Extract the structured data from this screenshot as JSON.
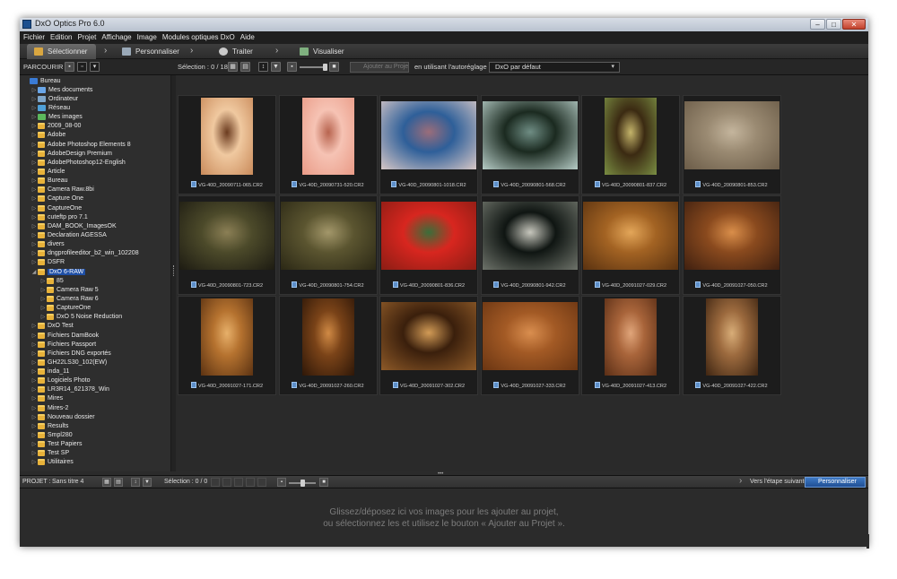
{
  "window": {
    "title": "DxO Optics Pro 6.0",
    "minimize": "–",
    "maximize": "□",
    "close": "✕"
  },
  "menu": [
    "Fichier",
    "Edition",
    "Projet",
    "Affichage",
    "Image",
    "Modules optiques DxO",
    "Aide"
  ],
  "steps": {
    "select": "Sélectionner",
    "customize": "Personnaliser",
    "process": "Traiter",
    "view": "Visualiser",
    "chevron": "›"
  },
  "toolbar": {
    "browse_label": "PARCOURIR :",
    "selection": "Sélection : 0 / 18",
    "add_button": "Ajouter au Projet",
    "autopreset_label": "en utilisant l'autoréglage :",
    "preset_value": "DxO par défaut",
    "preset_arrow": "▾"
  },
  "tree": [
    {
      "label": "Bureau",
      "level": 0,
      "icon": "desktop-icon",
      "exp": ""
    },
    {
      "label": "Mes documents",
      "level": 1,
      "icon": "documents-icon",
      "exp": "▷"
    },
    {
      "label": "Ordinateur",
      "level": 1,
      "icon": "computer-icon",
      "exp": "▷"
    },
    {
      "label": "Réseau",
      "level": 1,
      "icon": "network-icon",
      "exp": "▷"
    },
    {
      "label": "Mes images",
      "level": 1,
      "icon": "pictures-icon",
      "exp": "▷"
    },
    {
      "label": "2009_08-00",
      "level": 1,
      "icon": "folder-icon",
      "exp": "▷"
    },
    {
      "label": "Adobe",
      "level": 1,
      "icon": "folder-icon",
      "exp": "▷"
    },
    {
      "label": "Adobe Photoshop Elements 8",
      "level": 1,
      "icon": "folder-icon",
      "exp": "▷"
    },
    {
      "label": "AdobeDesign Premium",
      "level": 1,
      "icon": "folder-icon",
      "exp": "▷"
    },
    {
      "label": "AdobePhotoshop12-English",
      "level": 1,
      "icon": "folder-icon",
      "exp": "▷"
    },
    {
      "label": "Article",
      "level": 1,
      "icon": "folder-icon",
      "exp": "▷"
    },
    {
      "label": "Bureau",
      "level": 1,
      "icon": "folder-icon",
      "exp": "▷"
    },
    {
      "label": "Camera Raw.8bi",
      "level": 1,
      "icon": "folder-icon",
      "exp": "▷"
    },
    {
      "label": "Capture One",
      "level": 1,
      "icon": "folder-icon",
      "exp": "▷"
    },
    {
      "label": "CaptureOne",
      "level": 1,
      "icon": "folder-icon",
      "exp": "▷"
    },
    {
      "label": "cuteftp pro 7.1",
      "level": 1,
      "icon": "folder-icon",
      "exp": "▷"
    },
    {
      "label": "DAM_BOOK_ImagesOK",
      "level": 1,
      "icon": "folder-icon",
      "exp": "▷"
    },
    {
      "label": "Declaration AGESSA",
      "level": 1,
      "icon": "folder-icon",
      "exp": "▷"
    },
    {
      "label": "divers",
      "level": 1,
      "icon": "folder-icon",
      "exp": "▷"
    },
    {
      "label": "dngprofileeditor_b2_win_102208",
      "level": 1,
      "icon": "folder-icon",
      "exp": "▷"
    },
    {
      "label": "DSFR",
      "level": 1,
      "icon": "folder-icon",
      "exp": "▷"
    },
    {
      "label": "DxO 6-RAW",
      "level": 1,
      "icon": "folder-icon",
      "exp": "◢",
      "selected": true
    },
    {
      "label": "85",
      "level": 2,
      "icon": "folder-icon",
      "exp": "▷"
    },
    {
      "label": "Camera Raw 5",
      "level": 2,
      "icon": "folder-icon",
      "exp": "▷"
    },
    {
      "label": "Camera Raw 6",
      "level": 2,
      "icon": "folder-icon",
      "exp": "▷"
    },
    {
      "label": "CaptureOne",
      "level": 2,
      "icon": "folder-icon",
      "exp": "▷"
    },
    {
      "label": "DxO 5 Noise Reduction",
      "level": 2,
      "icon": "folder-icon",
      "exp": "▷"
    },
    {
      "label": "DxO Test",
      "level": 1,
      "icon": "folder-icon",
      "exp": "▷"
    },
    {
      "label": "Fichiers DamBook",
      "level": 1,
      "icon": "folder-icon",
      "exp": "▷"
    },
    {
      "label": "Fichiers Passport",
      "level": 1,
      "icon": "folder-icon",
      "exp": "▷"
    },
    {
      "label": "Fichiers DNG exportés",
      "level": 1,
      "icon": "folder-icon",
      "exp": "▷"
    },
    {
      "label": "GH22LS30_102(EW)",
      "level": 1,
      "icon": "folder-icon",
      "exp": "▷"
    },
    {
      "label": "inda_11",
      "level": 1,
      "icon": "folder-icon",
      "exp": "▷"
    },
    {
      "label": "Logiciels Photo",
      "level": 1,
      "icon": "folder-icon",
      "exp": "▷"
    },
    {
      "label": "LR3R14_621378_Win",
      "level": 1,
      "icon": "folder-icon",
      "exp": "▷"
    },
    {
      "label": "Mires",
      "level": 1,
      "icon": "folder-icon",
      "exp": "▷"
    },
    {
      "label": "Mires-2",
      "level": 1,
      "icon": "folder-icon",
      "exp": "▷"
    },
    {
      "label": "Nouveau dossier",
      "level": 1,
      "icon": "folder-icon",
      "exp": "▷"
    },
    {
      "label": "Results",
      "level": 1,
      "icon": "folder-icon",
      "exp": "▷"
    },
    {
      "label": "Smpl280",
      "level": 1,
      "icon": "folder-icon",
      "exp": "▷"
    },
    {
      "label": "Test Papiers",
      "level": 1,
      "icon": "folder-icon",
      "exp": "▷"
    },
    {
      "label": "Test SP",
      "level": 1,
      "icon": "folder-icon",
      "exp": "▷"
    },
    {
      "label": "Utilitaires",
      "level": 1,
      "icon": "folder-icon",
      "exp": "▷"
    }
  ],
  "thumbnails": [
    {
      "file": "VG-40D_20090711-065.CR2",
      "orient": "portrait",
      "colors": [
        "#f0c9a0",
        "#c98a5a",
        "#6b3b1f"
      ]
    },
    {
      "file": "VG-40D_20090731-520.CR2",
      "orient": "portrait",
      "colors": [
        "#f6c3b4",
        "#e99a86",
        "#b8644f"
      ]
    },
    {
      "file": "VG-40D_20090801-1018.CR2",
      "orient": "landscape",
      "colors": [
        "#2e5f99",
        "#d7c7c6",
        "#9b6d7a"
      ]
    },
    {
      "file": "VG-40D_20090801-568.CR2",
      "orient": "landscape",
      "colors": [
        "#1b2a20",
        "#b6ccc6",
        "#6f8d84"
      ]
    },
    {
      "file": "VG-40D_20090801-837.CR2",
      "orient": "portrait",
      "colors": [
        "#3b2a12",
        "#7a8e43",
        "#c4b46a"
      ]
    },
    {
      "file": "VG-40D_20090801-853.CR2",
      "orient": "landscape",
      "colors": [
        "#9a8a72",
        "#6b5c48",
        "#c4b59d"
      ]
    },
    {
      "file": "VG-40D_20090801-723.CR2",
      "orient": "landscape",
      "colors": [
        "#4c4a2a",
        "#1d1b12",
        "#8b7f55"
      ]
    },
    {
      "file": "VG-40D_20090801-754.CR2",
      "orient": "landscape",
      "colors": [
        "#5b5530",
        "#2b2815",
        "#a3976a"
      ]
    },
    {
      "file": "VG-40D_20090801-836.CR2",
      "orient": "landscape",
      "colors": [
        "#d8261f",
        "#8b1d14",
        "#3a6e3a"
      ]
    },
    {
      "file": "VG-40D_20090801-942.CR2",
      "orient": "landscape",
      "colors": [
        "#0f1512",
        "#6e736a",
        "#c7c7bd"
      ]
    },
    {
      "file": "VG-40D_20091027-029.CR2",
      "orient": "landscape",
      "colors": [
        "#a36323",
        "#5a3210",
        "#e3a659"
      ]
    },
    {
      "file": "VG-40D_20091027-050.CR2",
      "orient": "landscape",
      "colors": [
        "#8a4a1e",
        "#3f2010",
        "#d98e4a"
      ]
    },
    {
      "file": "VG-40D_20091027-171.CR2",
      "orient": "portrait",
      "colors": [
        "#b5722f",
        "#5b3212",
        "#e7b06a"
      ]
    },
    {
      "file": "VG-40D_20091027-260.CR2",
      "orient": "portrait",
      "colors": [
        "#7a4318",
        "#2e1708",
        "#d08a45"
      ]
    },
    {
      "file": "VG-40D_20091027-302.CR2",
      "orient": "landscape",
      "colors": [
        "#3a1f0c",
        "#8e5a28",
        "#d29b56"
      ]
    },
    {
      "file": "VG-40D_20091027-333.CR2",
      "orient": "landscape",
      "colors": [
        "#a35a25",
        "#6a3512",
        "#d98e4f"
      ]
    },
    {
      "file": "VG-40D_20091027-413.CR2",
      "orient": "portrait",
      "colors": [
        "#a8643a",
        "#5a2e16",
        "#e0a57a"
      ]
    },
    {
      "file": "VG-40D_20091027-422.CR2",
      "orient": "portrait",
      "colors": [
        "#9c6a3e",
        "#3e2512",
        "#d8ad78"
      ]
    }
  ],
  "project": {
    "label": "PROJET :",
    "name": "Sans titre 4",
    "selection": "Sélection : 0 / 0",
    "next_step_label": "Vers l'étape suivante",
    "next_button": "Personnaliser",
    "chevron": "›",
    "drop_line1": "Glissez/déposez ici vos images pour les ajouter au projet,",
    "drop_line2": "ou sélectionnez les et utilisez le bouton « Ajouter au Projet »."
  }
}
